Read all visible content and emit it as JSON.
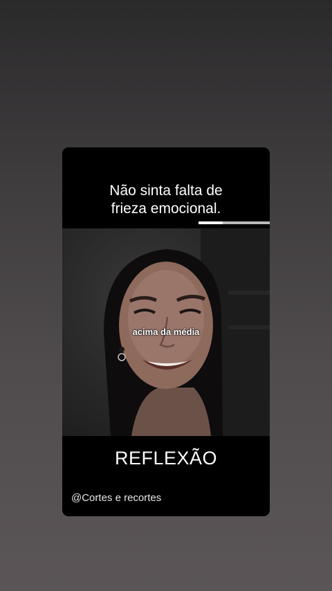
{
  "story": {
    "headline_line1": "Não sinta falta de",
    "headline_line2": "frieza emocional.",
    "progress": 0.34,
    "video": {
      "caption_overlay": "acima da média"
    },
    "footer_title": "REFLEXÃO",
    "account_handle": "@Cortes e recortes"
  },
  "colors": {
    "background_top": "#2b2a2b",
    "background_bottom": "#5b5557",
    "card": "#000000",
    "text": "#ffffff",
    "progress_track": "#b9b9b9",
    "progress_fill": "#ffffff"
  }
}
